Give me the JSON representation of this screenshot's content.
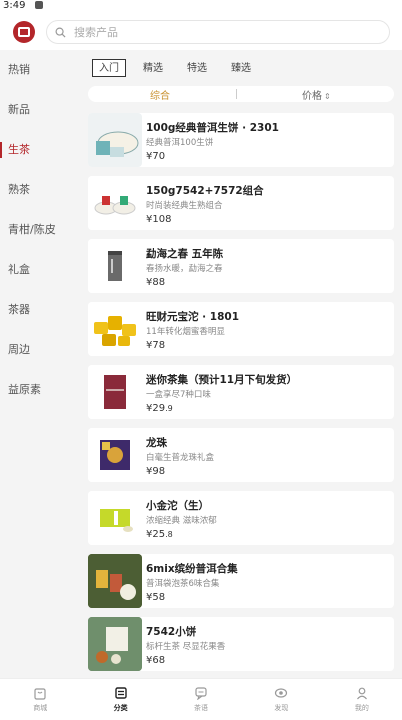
{
  "status": {
    "time": "3:49"
  },
  "search": {
    "placeholder": "搜索产品"
  },
  "sidebar": {
    "items": [
      {
        "label": "热销"
      },
      {
        "label": "新品"
      },
      {
        "label": "生茶"
      },
      {
        "label": "熟茶"
      },
      {
        "label": "青柑/陈皮"
      },
      {
        "label": "礼盒"
      },
      {
        "label": "茶器"
      },
      {
        "label": "周边"
      },
      {
        "label": "益原素"
      }
    ],
    "active_index": 2
  },
  "subtabs": [
    {
      "label": "入门"
    },
    {
      "label": "精选"
    },
    {
      "label": "特选"
    },
    {
      "label": "臻选"
    }
  ],
  "sort": {
    "default": "综合",
    "price": "价格",
    "price_arrows": "⇕"
  },
  "products": [
    {
      "name": "100g经典普洱生饼 · 2301",
      "desc": "经典普洱100生饼",
      "price": "¥70",
      "dec": ""
    },
    {
      "name": "150g7542+7572组合",
      "desc": "时尚装经典生熟组合",
      "price": "¥108",
      "dec": ""
    },
    {
      "name": "勐海之春 五年陈",
      "desc": "春扬水暖，勐海之春",
      "price": "¥88",
      "dec": ""
    },
    {
      "name": "旺财元宝沱 · 1801",
      "desc": "11年转化烟蜜香明显",
      "price": "¥78",
      "dec": ""
    },
    {
      "name": "迷你茶集（预计11月下旬发货）",
      "desc": "一盒享尽7种口味",
      "price": "¥29",
      "dec": ".9"
    },
    {
      "name": "龙珠",
      "desc": "白毫生普龙珠礼盒",
      "price": "¥98",
      "dec": ""
    },
    {
      "name": "小金沱（生）",
      "desc": "浓缩经典 滋味浓郁",
      "price": "¥25",
      "dec": ".8"
    },
    {
      "name": "6mix缤纷普洱合集",
      "desc": "普洱袋泡茶6味合集",
      "price": "¥58",
      "dec": ""
    },
    {
      "name": "7542小饼",
      "desc": "标杆生茶 尽显花果香",
      "price": "¥68",
      "dec": ""
    }
  ],
  "bottom_nav": [
    {
      "label": "商城",
      "icon": "bag-icon"
    },
    {
      "label": "分类",
      "icon": "category-icon"
    },
    {
      "label": "茶语",
      "icon": "chat-icon"
    },
    {
      "label": "发现",
      "icon": "eye-icon"
    },
    {
      "label": "我的",
      "icon": "user-icon"
    }
  ],
  "colors": {
    "brand": "#b3262a",
    "sort_active": "#c8902e"
  }
}
